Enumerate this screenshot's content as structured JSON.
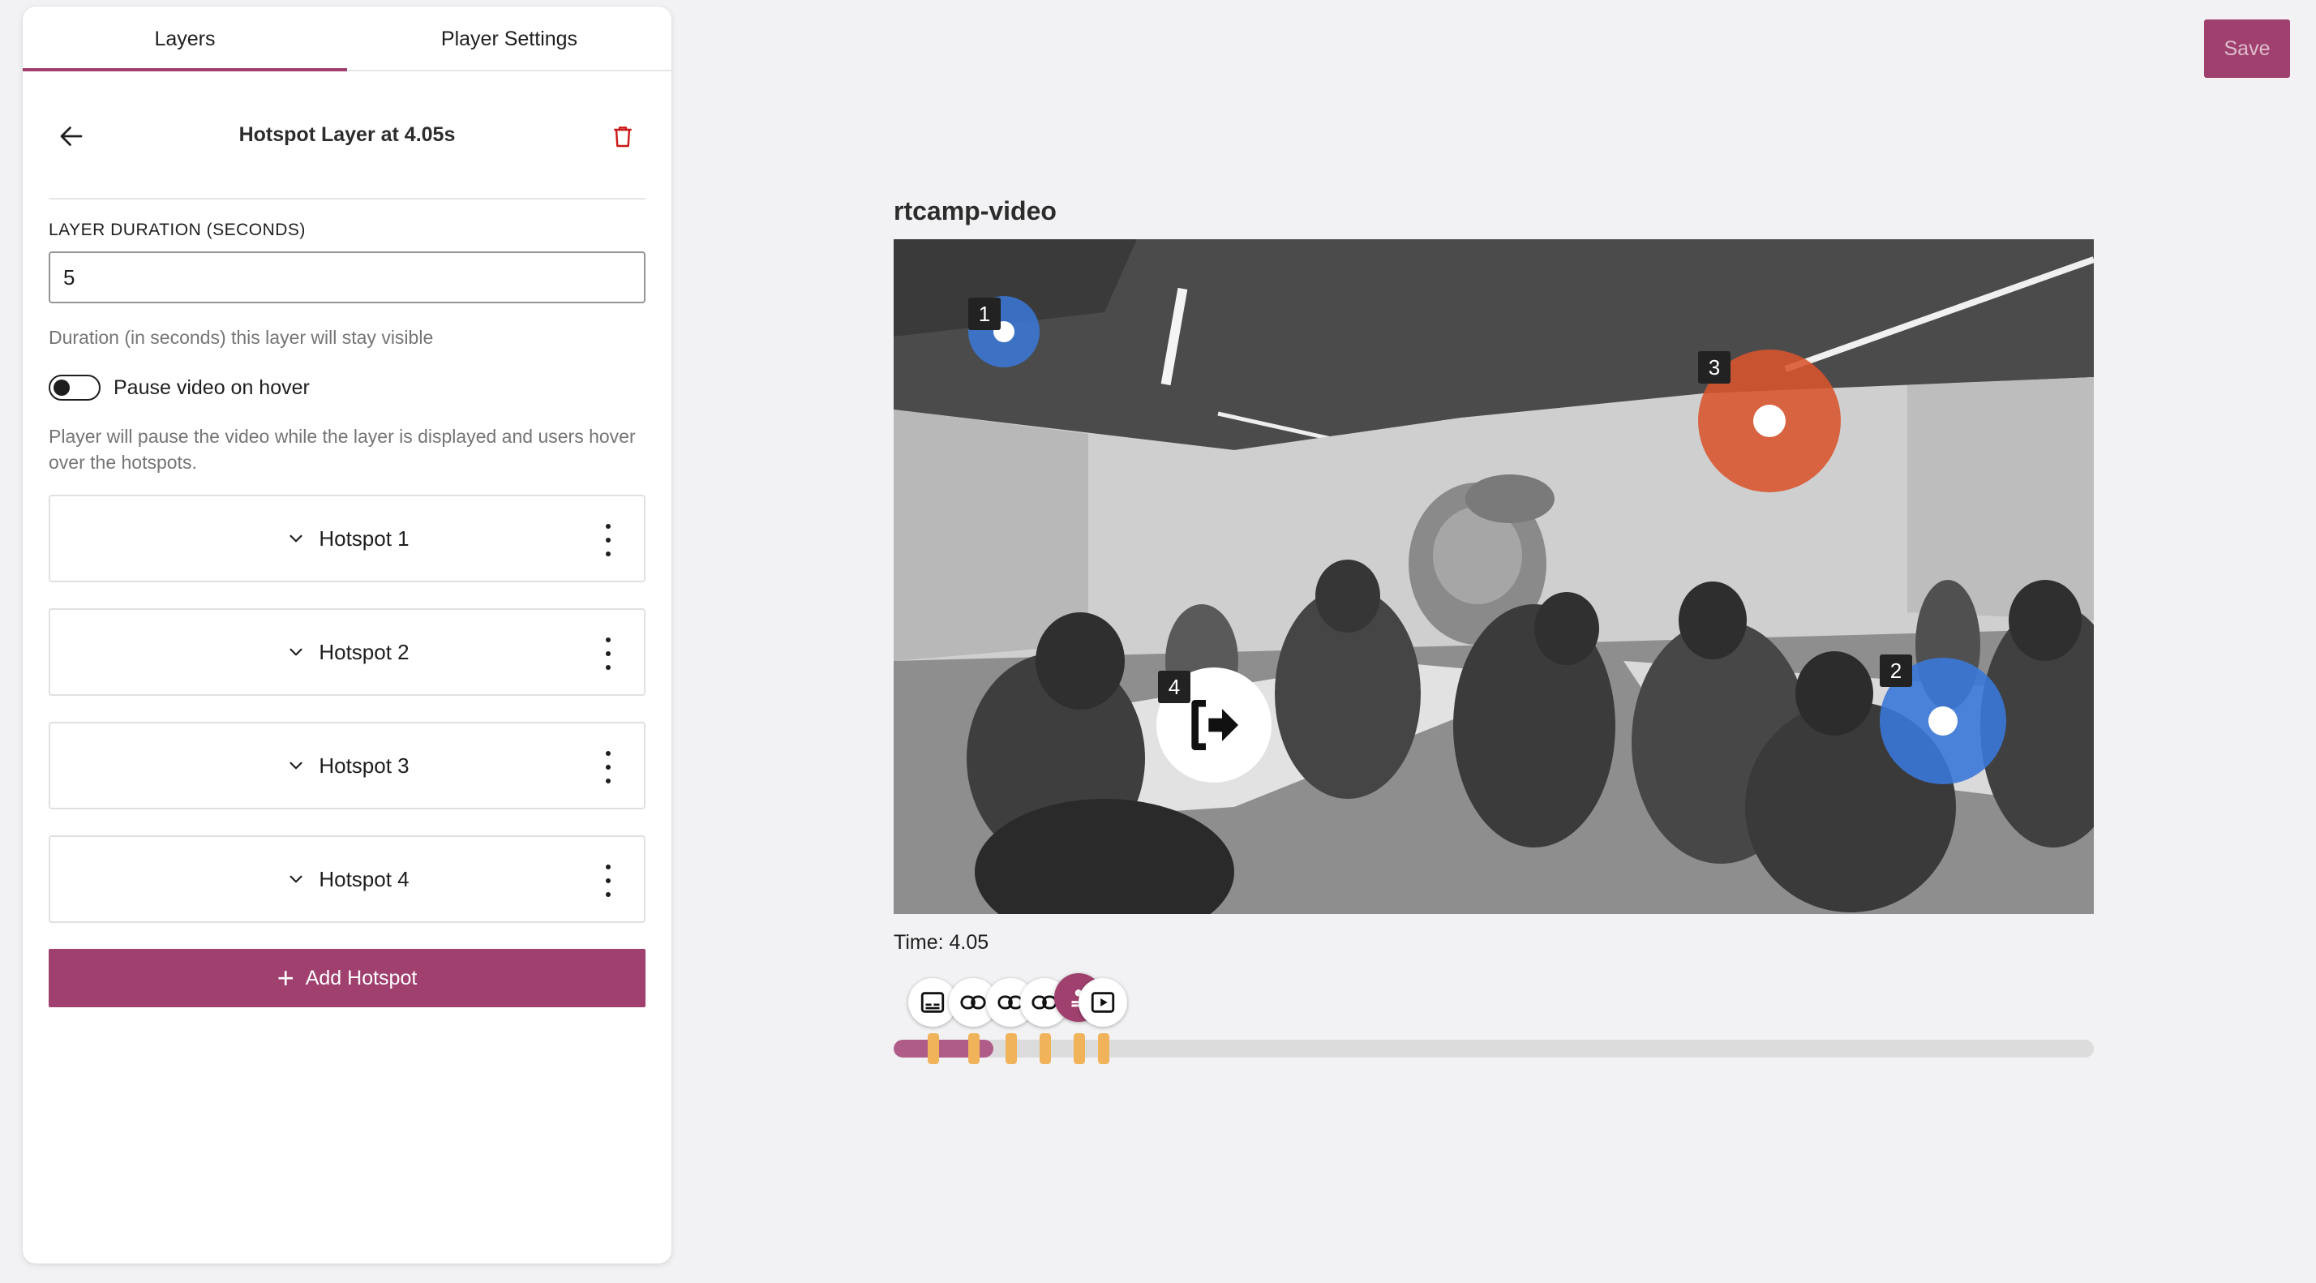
{
  "tabs": [
    {
      "label": "Layers",
      "active": true
    },
    {
      "label": "Player Settings",
      "active": false
    }
  ],
  "layer": {
    "title": "Hotspot Layer at 4.05s",
    "duration_label": "LAYER DURATION (SECONDS)",
    "duration_value": "5",
    "duration_help": "Duration (in seconds) this layer will stay visible",
    "pause_toggle_label": "Pause video on hover",
    "pause_toggle_on": false,
    "pause_help": "Player will pause the video while the layer is displayed and users hover over the hotspots."
  },
  "hotspots": [
    {
      "label": "Hotspot 1"
    },
    {
      "label": "Hotspot 2"
    },
    {
      "label": "Hotspot 3"
    },
    {
      "label": "Hotspot 4"
    }
  ],
  "add_hotspot_label": "Add Hotspot",
  "save_label": "Save",
  "video": {
    "title": "rtcamp-video",
    "time_text": "Time: 4.05",
    "hotspot_badges": [
      "1",
      "2",
      "3",
      "4"
    ],
    "colors": {
      "blue": "#3b78d8",
      "orange": "#d9542c"
    }
  },
  "timeline": {
    "progress_fraction": 0.083,
    "markers": [
      {
        "icon": "subtitles-icon"
      },
      {
        "icon": "link-icon"
      },
      {
        "icon": "link-icon"
      },
      {
        "icon": "link-icon"
      },
      {
        "icon": "hotspot-icon",
        "active": true
      },
      {
        "icon": "video-play-icon"
      }
    ]
  },
  "accent_color": "#a0406e"
}
